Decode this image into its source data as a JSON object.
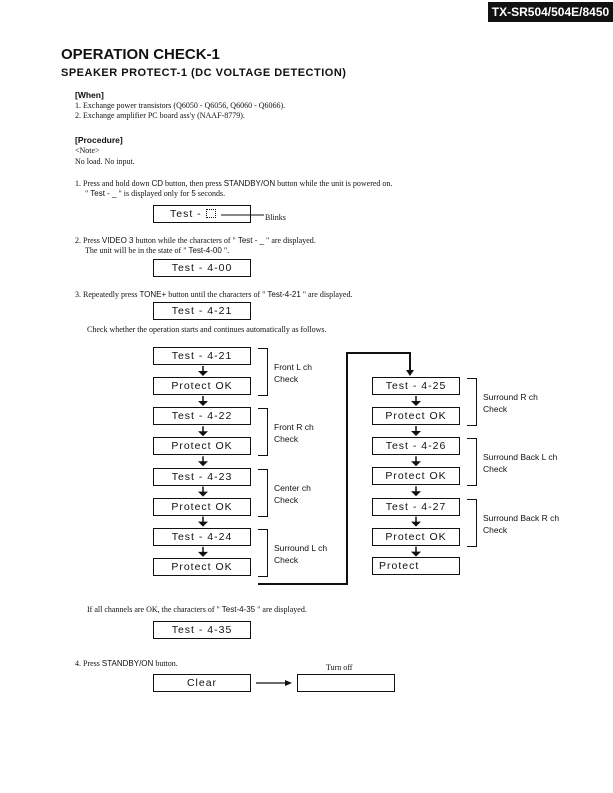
{
  "header": {
    "model": "TX-SR504/504E/8450"
  },
  "title": "OPERATION CHECK-1",
  "subtitle": "SPEAKER PROTECT-1 (DC VOLTAGE DETECTION)",
  "when": {
    "heading": "[When]",
    "items": [
      "1. Exchange power transistors (Q6050 - Q6056, Q6060 - Q6066).",
      "2. Exchange amplifier PC board ass'y (NAAF-8779)."
    ]
  },
  "procedure": {
    "heading": "[Procedure]",
    "note": "<Note>",
    "note_text": "No load.  No input."
  },
  "step1": {
    "line1a": "1. Press and hold down ",
    "cd": "CD",
    "line1b": " button, then press ",
    "standby": "STANDBY/ON",
    "line1c": " button while the unit is powered on.",
    "line2a": "\" ",
    "test": "Test - _",
    "line2b": " \"  is displayed only for ",
    "five": "5",
    "line2c": " seconds.",
    "box": "Test - ",
    "blinks": "Blinks"
  },
  "step2": {
    "line1a": "2. Press ",
    "video": "VIDEO 3",
    "line1b": " button while the characters of \" ",
    "test": "Test - _",
    "line1c": " \"  are displayed.",
    "line2a": "The unit will be in the state of \"  ",
    "state": "Test-4-00",
    "line2b": " \".",
    "box": "Test - 4-00"
  },
  "step3": {
    "line1a": "3. Repeatedly press ",
    "tone": "TONE+",
    "line1b": " button until the characters of \" ",
    "test": "Test-4-21",
    "line1c": " \" are displayed.",
    "box": "Test - 4-21",
    "check": "Check whether the operation starts and continues automatically as follows."
  },
  "flow_left": [
    {
      "test": "Test - 4-21",
      "result": "Protect OK",
      "label1": "Front L ch",
      "label2": "Check"
    },
    {
      "test": "Test - 4-22",
      "result": "Protect OK",
      "label1": "Front R ch",
      "label2": "Check"
    },
    {
      "test": "Test - 4-23",
      "result": "Protect OK",
      "label1": "Center ch",
      "label2": "Check"
    },
    {
      "test": "Test - 4-24",
      "result": "Protect OK",
      "label1": "Surround L ch",
      "label2": "Check"
    }
  ],
  "flow_right": [
    {
      "test": "Test - 4-25",
      "result": "Protect OK",
      "label1": "Surround R ch",
      "label2": "Check"
    },
    {
      "test": "Test - 4-26",
      "result": "Protect OK",
      "label1": "Surround Back L ch",
      "label2": "Check"
    },
    {
      "test": "Test - 4-27",
      "result": "Protect OK",
      "label1": "Surround Back R ch",
      "label2": "Check"
    }
  ],
  "flow_end": "Protect",
  "all_ok": {
    "line_a": "If all channels are OK, the characters of \" ",
    "test": "Test-4-35",
    "line_b": " \" are displayed.",
    "box": "Test - 4-35"
  },
  "step4": {
    "line_a": "4. Press ",
    "standby": "STANDBY/ON",
    "line_b": " button.",
    "box": "Clear",
    "turn_off": "Turn off",
    "result_box": ""
  }
}
